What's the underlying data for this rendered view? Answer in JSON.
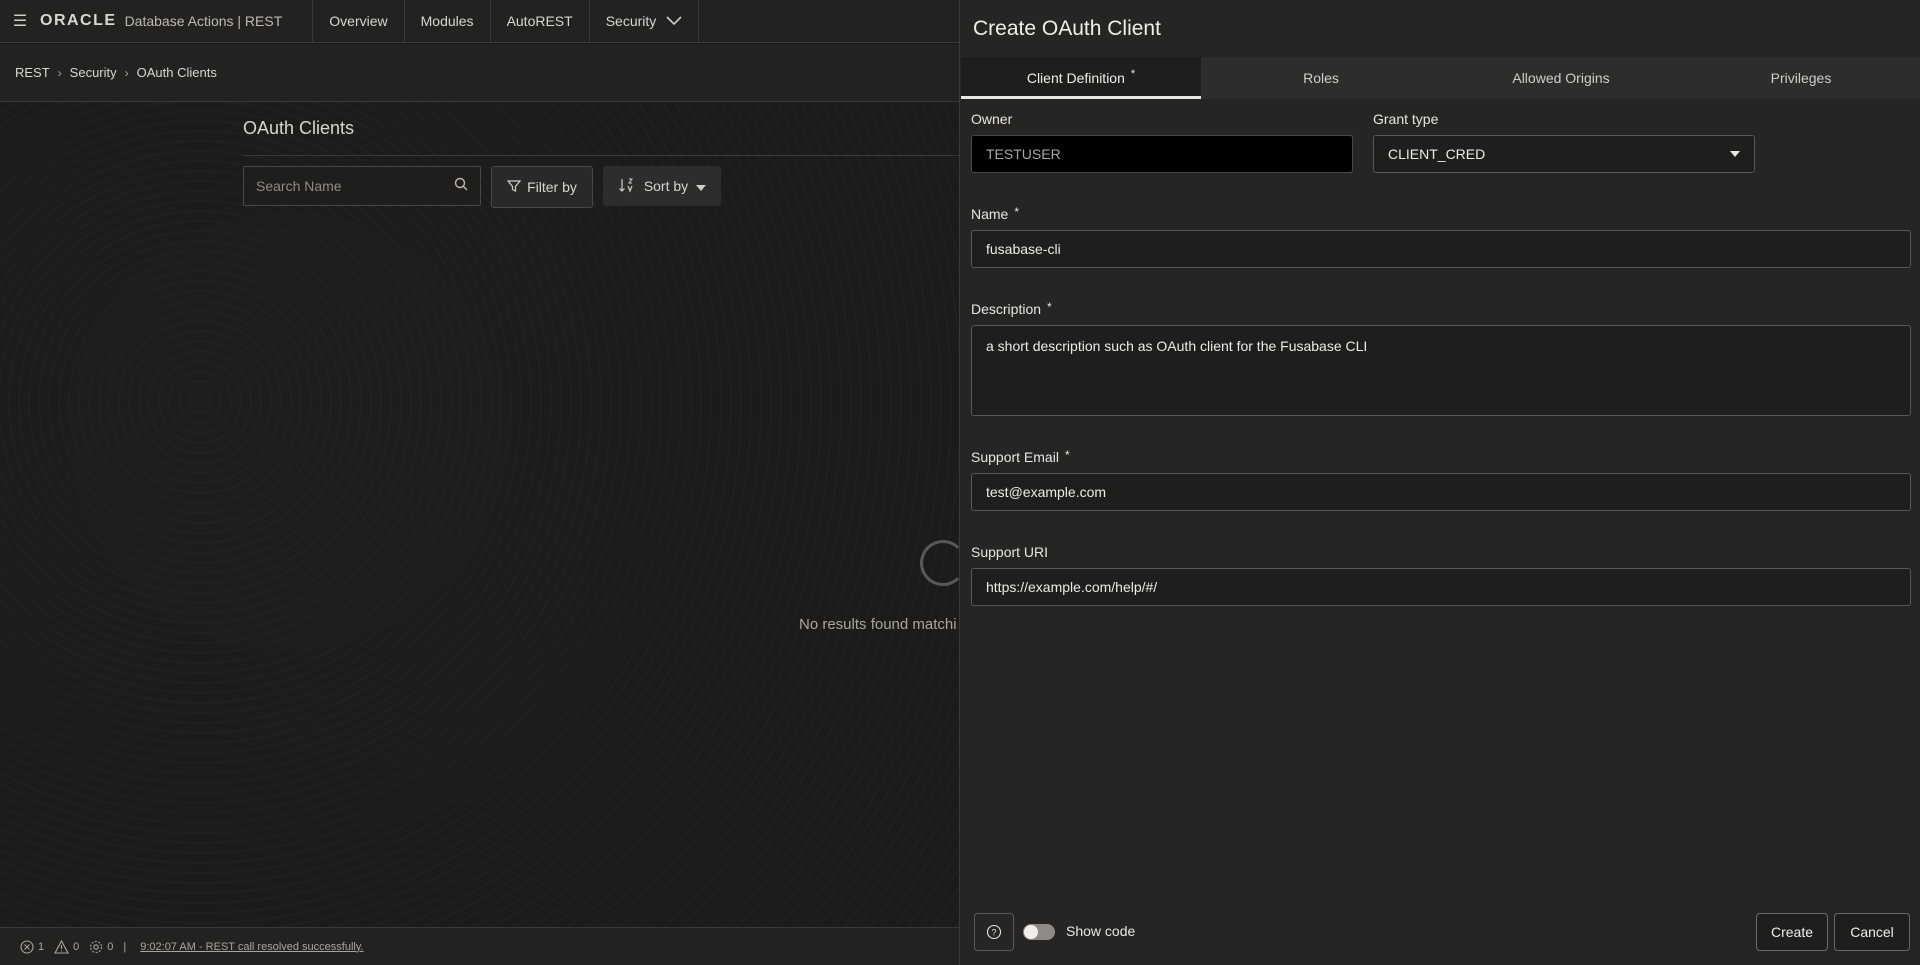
{
  "topbar": {
    "brand_logo": "ORACLE",
    "brand_product": "Database Actions |  REST",
    "nav": [
      {
        "label": "Overview"
      },
      {
        "label": "Modules"
      },
      {
        "label": "AutoREST"
      },
      {
        "label": "Security"
      }
    ]
  },
  "breadcrumb": [
    "REST",
    "Security",
    "OAuth Clients"
  ],
  "list": {
    "title": "OAuth Clients",
    "search_placeholder": "Search Name",
    "filter_label": "Filter by",
    "sort_label": "Sort by",
    "empty_text": "No results found matchi"
  },
  "statusbar": {
    "errors": "1",
    "warnings": "0",
    "settings": "0",
    "separator": "|",
    "message": "9:02:07 AM - REST call resolved successfully."
  },
  "drawer": {
    "title": "Create OAuth Client",
    "tabs": [
      {
        "label": "Client Definition",
        "required": "*",
        "active": true
      },
      {
        "label": "Roles"
      },
      {
        "label": "Allowed Origins"
      },
      {
        "label": "Privileges"
      }
    ],
    "fields": {
      "owner": {
        "label": "Owner",
        "value": "TESTUSER"
      },
      "grant_type": {
        "label": "Grant type",
        "value": "CLIENT_CRED"
      },
      "name": {
        "label": "Name",
        "required": "*",
        "value": "fusabase-cli"
      },
      "description": {
        "label": "Description",
        "required": "*",
        "value": "a short description such as OAuth client for the Fusabase CLI"
      },
      "support_email": {
        "label": "Support Email",
        "required": "*",
        "value": "test@example.com"
      },
      "support_uri": {
        "label": "Support URI",
        "value": "https://example.com/help/#/"
      }
    },
    "footer": {
      "help_icon_glyph": "?",
      "show_code_label": "Show code",
      "create_label": "Create",
      "cancel_label": "Cancel"
    }
  }
}
